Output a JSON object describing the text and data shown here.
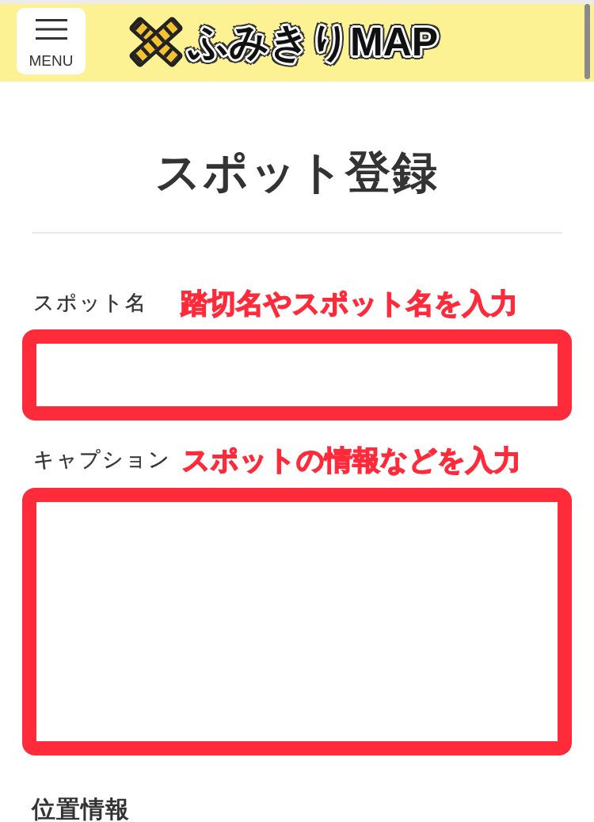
{
  "header": {
    "menu_button": {
      "label": "MENU"
    },
    "logo": {
      "text": "ふみきりMAP"
    }
  },
  "page_title": "スポット登録",
  "fields": [
    {
      "kind": "input",
      "label": "スポット名",
      "annotation": "踏切名やスポット名を入力",
      "highlighted": true
    },
    {
      "kind": "textarea",
      "label": "キャプション",
      "annotation": "スポットの情報などを入力",
      "highlighted": true
    }
  ],
  "section_heading": "位置情報"
}
